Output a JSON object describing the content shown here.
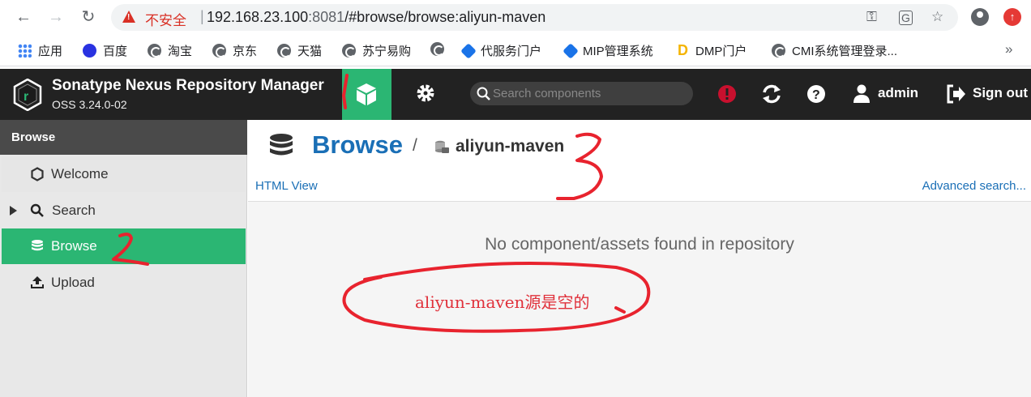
{
  "browser": {
    "insecure_label": "不安全",
    "url_host": "192.168.23.100",
    "url_port": ":8081",
    "url_path": "/#browse/browse:aliyun-maven",
    "bookmarks": [
      {
        "label": "应用",
        "icon": "apps-grid-icon"
      },
      {
        "label": "百度",
        "icon": "baidu-icon"
      },
      {
        "label": "淘宝",
        "icon": "globe-icon"
      },
      {
        "label": "京东",
        "icon": "globe-icon"
      },
      {
        "label": "天猫",
        "icon": "globe-icon"
      },
      {
        "label": "苏宁易购",
        "icon": "globe-icon"
      },
      {
        "label": "代服务门户",
        "icon": "globe-icon"
      },
      {
        "label": "MIP管理系统",
        "icon": "mip-icon"
      },
      {
        "label": "DMP门户",
        "icon": "dmp-icon"
      },
      {
        "label": "CMI系统管理登录...",
        "icon": "globe-icon"
      }
    ],
    "more_label": "»"
  },
  "header": {
    "title": "Sonatype Nexus Repository Manager",
    "version": "OSS 3.24.0-02",
    "search_placeholder": "Search components",
    "user": "admin",
    "signout": "Sign out",
    "accent": "#2bb673"
  },
  "sidebar": {
    "header": "Browse",
    "items": [
      {
        "label": "Welcome",
        "icon": "hexagon-icon"
      },
      {
        "label": "Search",
        "icon": "search-icon"
      },
      {
        "label": "Browse",
        "icon": "database-icon"
      },
      {
        "label": "Upload",
        "icon": "upload-icon"
      }
    ]
  },
  "main": {
    "title": "Browse",
    "separator": "/",
    "repo": "aliyun-maven",
    "html_view": "HTML View",
    "advanced_search": "Advanced search...",
    "empty_message": "No component/assets found in repository"
  },
  "annotations": {
    "note": "aliyun-maven源是空的",
    "color": "#e0303a"
  }
}
